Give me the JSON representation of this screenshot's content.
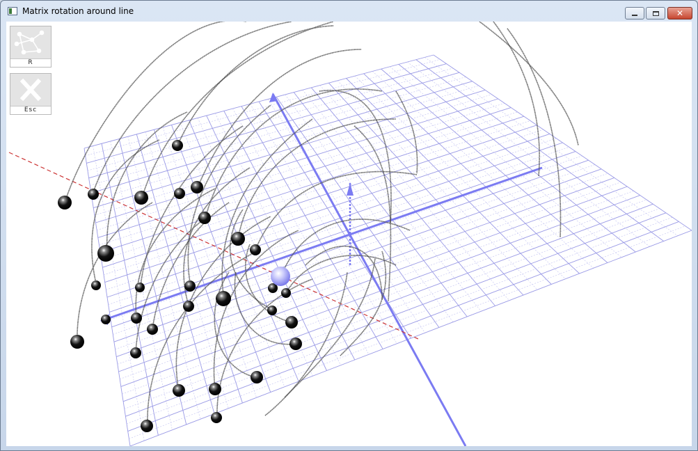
{
  "window": {
    "title": "Matrix rotation around line"
  },
  "window_controls": {
    "minimize": "minimize-icon",
    "maximize": "maximize-icon",
    "close": "close-icon"
  },
  "toolbar": {
    "reset": {
      "label": "R",
      "icon": "graph-nodes-icon"
    },
    "escape": {
      "label": "Esc",
      "icon": "x-icon"
    }
  },
  "colors": {
    "grid": "#9a9ae6",
    "grid_fine": "#c9c9f3",
    "axis": "#7b7bf2",
    "rotation_line": "#cc3333",
    "trajectory": "#555555",
    "sphere": "#0a0a0a",
    "pivot_sphere": "#8e8ef4"
  }
}
